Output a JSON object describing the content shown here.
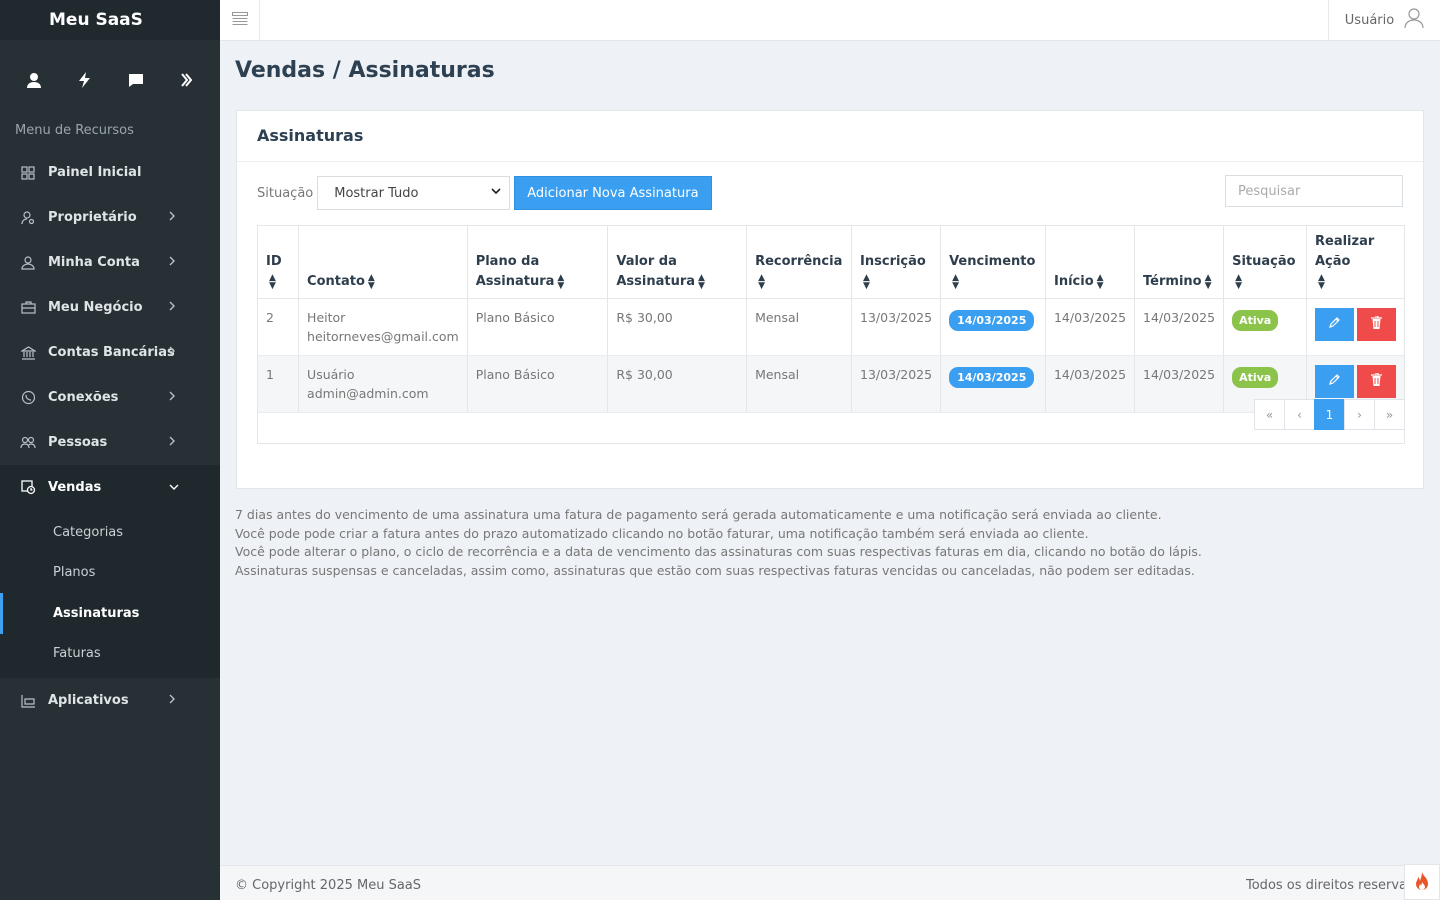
{
  "brand": "Meu SaaS",
  "sidebar": {
    "menu_title": "Menu de Recursos",
    "quick_icons": [
      "user-icon",
      "bolt-icon",
      "chat-icon",
      "double-chevron-icon"
    ],
    "items": [
      {
        "label": "Painel Inicial",
        "icon": "grid-icon"
      },
      {
        "label": "Proprietário",
        "icon": "user-key-icon"
      },
      {
        "label": "Minha Conta",
        "icon": "user-icon"
      },
      {
        "label": "Meu Negócio",
        "icon": "briefcase-icon"
      },
      {
        "label": "Contas Bancárias",
        "icon": "bank-icon"
      },
      {
        "label": "Conexões",
        "icon": "whatsapp-icon"
      },
      {
        "label": "Pessoas",
        "icon": "people-icon"
      },
      {
        "label": "Vendas",
        "icon": "sales-icon"
      },
      {
        "label": "Aplicativos",
        "icon": "apps-icon"
      }
    ],
    "sub_items": [
      "Categorias",
      "Planos",
      "Assinaturas",
      "Faturas"
    ]
  },
  "topbar": {
    "user_label": "Usuário"
  },
  "page": {
    "title": "Vendas / Assinaturas"
  },
  "card": {
    "title": "Assinaturas",
    "filter_label": "Situação",
    "filter_value": "Mostrar Tudo",
    "add_button": "Adicionar Nova Assinatura",
    "search_placeholder": "Pesquisar"
  },
  "table": {
    "headers": {
      "id": "ID",
      "contato": "Contato",
      "plano_1": "Plano da",
      "plano_2": "Assinatura",
      "valor_1": "Valor da",
      "valor_2": "Assinatura",
      "recorrencia": "Recorrência",
      "inscricao": "Inscrição",
      "vencimento": "Vencimento",
      "inicio": "Início",
      "termino": "Término",
      "situacao": "Situação",
      "acao": "Realizar Ação"
    },
    "rows": [
      {
        "id": "2",
        "name": "Heitor",
        "email": "heitorneves@gmail.com",
        "plano": "Plano Básico",
        "valor": "R$ 30,00",
        "recorrencia": "Mensal",
        "inscricao": "13/03/2025",
        "vencimento": "14/03/2025",
        "inicio": "14/03/2025",
        "termino": "14/03/2025",
        "situacao": "Ativa"
      },
      {
        "id": "1",
        "name": "Usuário",
        "email": "admin@admin.com",
        "plano": "Plano Básico",
        "valor": "R$ 30,00",
        "recorrencia": "Mensal",
        "inscricao": "13/03/2025",
        "vencimento": "14/03/2025",
        "inicio": "14/03/2025",
        "termino": "14/03/2025",
        "situacao": "Ativa"
      }
    ]
  },
  "pagination": {
    "first": "«",
    "prev": "‹",
    "current": "1",
    "next": "›",
    "last": "»"
  },
  "notes": [
    "7 dias antes do vencimento de uma assinatura uma fatura de pagamento será gerada automaticamente e uma notificação será enviada ao cliente.",
    "Você pode pode criar a fatura antes do prazo automatizado clicando no botão faturar, uma notificação também será enviada ao cliente.",
    "Você pode alterar o plano, o ciclo de recorrência e a data de vencimento das assinaturas com suas respectivas faturas em dia, clicando no botão do lápis.",
    "Assinaturas suspensas e canceladas, assim como, assinaturas que estão com suas respectivas faturas vencidas ou canceladas, não podem ser editadas."
  ],
  "footer": {
    "copyright": "© Copyright 2025 Meu SaaS",
    "rights": "Todos os direitos reservados"
  },
  "colors": {
    "sidebar": "#263035",
    "accent": "#3a9ff0",
    "danger": "#ef4b4b",
    "success": "#8cc34a"
  }
}
